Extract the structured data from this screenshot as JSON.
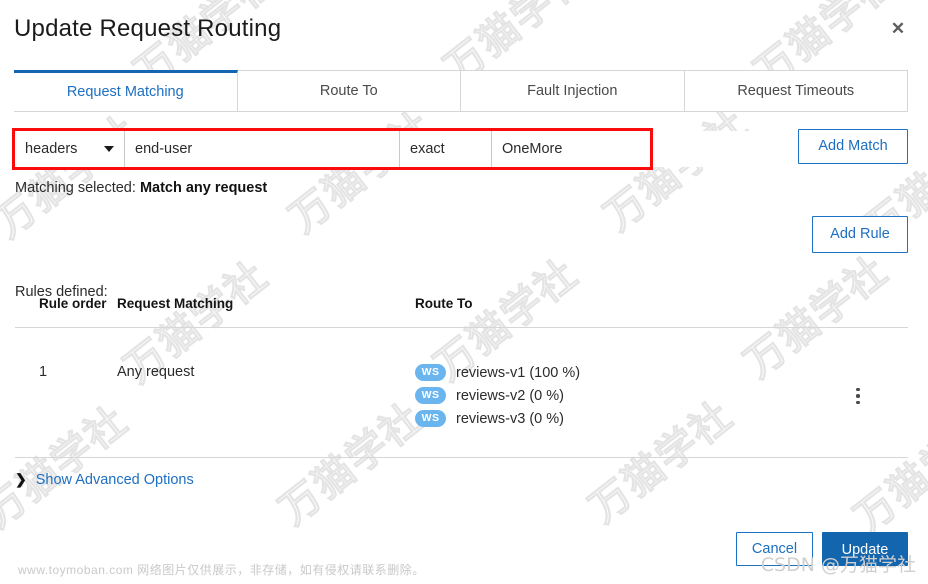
{
  "dialog": {
    "title": "Update Request Routing",
    "close_icon": "close-icon"
  },
  "tabs": [
    {
      "label": "Request Matching",
      "active": true
    },
    {
      "label": "Route To",
      "active": false
    },
    {
      "label": "Fault Injection",
      "active": false
    },
    {
      "label": "Request Timeouts",
      "active": false
    }
  ],
  "match_form": {
    "field_type": "headers",
    "field_name": "end-user",
    "operator": "exact",
    "value": "OneMore",
    "add_match_label": "Add Match",
    "highlight_color": "#fb0b0b"
  },
  "matching_selected": {
    "label": "Matching selected:",
    "value": "Match any request"
  },
  "add_rule_label": "Add Rule",
  "rules": {
    "heading": "Rules defined:",
    "columns": [
      "Rule order",
      "Request Matching",
      "Route To"
    ],
    "rows": [
      {
        "order": "1",
        "matching": "Any request",
        "routes": [
          {
            "badge": "WS",
            "label": "reviews-v1 (100 %)"
          },
          {
            "badge": "WS",
            "label": "reviews-v2 (0 %)"
          },
          {
            "badge": "WS",
            "label": "reviews-v3 (0 %)"
          }
        ]
      }
    ]
  },
  "advanced": {
    "chevron_icon": "chevron-right-icon",
    "label": "Show Advanced Options"
  },
  "footer": {
    "cancel_label": "Cancel",
    "update_label": "Update",
    "primary_color": "#1366ae"
  },
  "overlay": {
    "bottom_note": "www.toymoban.com 网络图片仅供展示，非存储，如有侵权请联系删除。",
    "csdn_watermark": "CSDN @万猫学社",
    "tile_watermark": "万猫学社"
  }
}
